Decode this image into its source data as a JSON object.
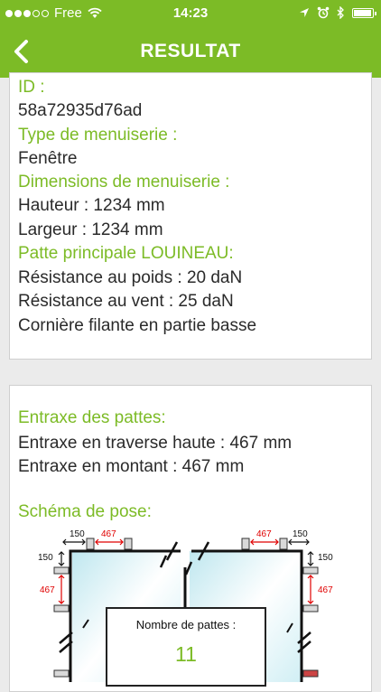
{
  "status_bar": {
    "carrier": "Free",
    "time": "14:23",
    "battery_level": 0.95
  },
  "nav": {
    "title": "RESULTAT",
    "back_icon": "chevron-left-icon"
  },
  "card1": {
    "id_label": "ID :",
    "id_value": "58a72935d76ad",
    "type_label": "Type de menuiserie :",
    "type_value": "Fenêtre",
    "dims_label": "Dimensions de menuiserie :",
    "hauteur": "Hauteur : 1234 mm",
    "largeur": "Largeur : 1234 mm",
    "patte_label": "Patte principale LOUINEAU:",
    "poids": "Résistance au poids : 20 daN",
    "vent": "Résistance au vent : 25 daN",
    "corniere": "Cornière filante en partie basse"
  },
  "card2": {
    "entraxe_label": "Entraxe des pattes:",
    "traverse": "Entraxe en traverse haute : 467 mm",
    "montant": "Entraxe en montant : 467 mm",
    "schema_label": "Schéma de pose:"
  },
  "schema": {
    "dim_150_top_left": "150",
    "dim_467_top_left": "467",
    "dim_467_top_right": "467",
    "dim_150_top_right": "150",
    "dim_150_left": "150",
    "dim_467_left": "467",
    "dim_150_right": "150",
    "dim_467_right": "467",
    "count_label": "Nombre de pattes :",
    "count_value": "11"
  },
  "colors": {
    "accent": "#7cbb26",
    "dimension_red": "#e00000"
  }
}
